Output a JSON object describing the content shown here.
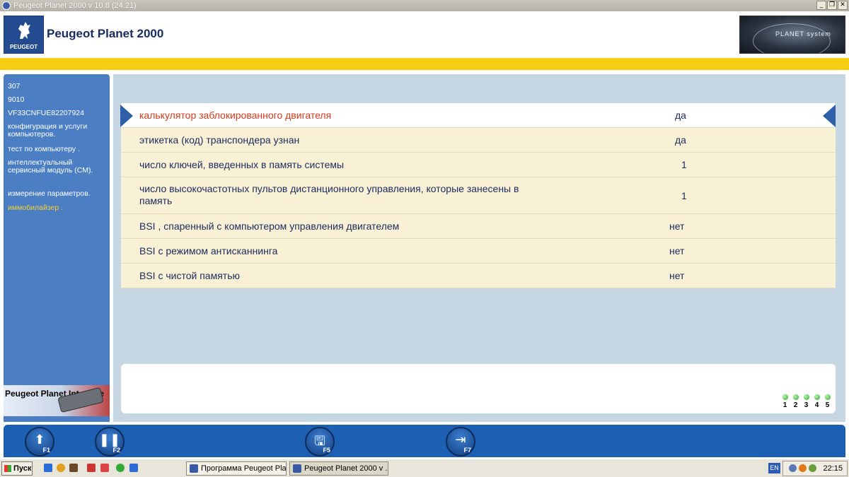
{
  "window": {
    "title": "Peugeot Planet 2000 v 10.8 (24.21)"
  },
  "header": {
    "app_title": "Peugeot Planet 2000",
    "brand": "PEUGEOT",
    "planet_system_logo": "PLANET system"
  },
  "sidebar": {
    "items": [
      {
        "label": "307"
      },
      {
        "label": "9010"
      },
      {
        "label": "VF33CNFUE82207924"
      },
      {
        "label": "конфигурация и услуги компьютеров."
      },
      {
        "label": "тест по компьютеру ."
      },
      {
        "label": "интеллектуальный сервисный модуль (СМ)."
      },
      {
        "label": "измерение параметров."
      },
      {
        "label": "иммобилайзер .",
        "active": true
      }
    ],
    "interface_label": "Peugeot Planet Interface"
  },
  "table": {
    "rows": [
      {
        "label": "калькулятор заблокированного двигателя",
        "value": "да",
        "selected": true
      },
      {
        "label": "этикетка (код) транспондера узнан",
        "value": "да"
      },
      {
        "label": "число ключей, введенных в память системы",
        "value": "1"
      },
      {
        "label": "число высокочастотных пультов дистанционного управления, которые занесены в память",
        "value": "1"
      },
      {
        "label": "BSI  , спаренный с компьютером управления двигателем",
        "value": "нет"
      },
      {
        "label": "BSI   с режимом антисканнинга",
        "value": "нет"
      },
      {
        "label": "BSI   с чистой памятью",
        "value": "нет"
      }
    ]
  },
  "steps": [
    "1",
    "2",
    "3",
    "4",
    "5"
  ],
  "function_keys": [
    {
      "label": "F1",
      "icon": "up-arrow-icon"
    },
    {
      "label": "F2",
      "icon": "pause-icon"
    },
    {
      "label": "F5",
      "icon": "save-print-icon"
    },
    {
      "label": "F7",
      "icon": "exit-icon"
    }
  ],
  "taskbar": {
    "start_label": "Пуск",
    "tasks": [
      "Программа Peugeot Plan...",
      "Peugeot Planet 2000 v ..."
    ],
    "lang": "EN",
    "clock": "22:15"
  },
  "colors": {
    "accent_yellow": "#f6cf13",
    "sidebar_blue": "#4b7ec3",
    "selected_text": "#d23a1e",
    "fbar_blue": "#1d5fb3"
  }
}
